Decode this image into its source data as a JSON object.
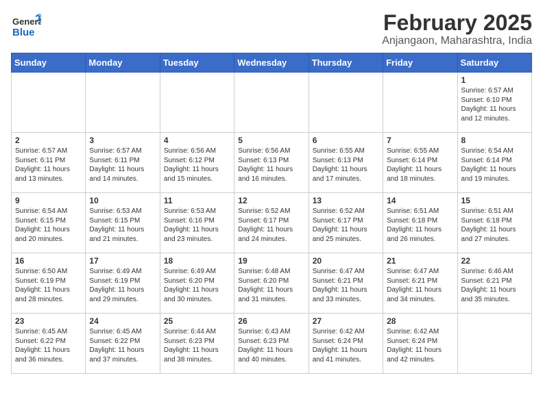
{
  "header": {
    "logo_general": "General",
    "logo_blue": "Blue",
    "month_title": "February 2025",
    "location": "Anjangaon, Maharashtra, India"
  },
  "weekdays": [
    "Sunday",
    "Monday",
    "Tuesday",
    "Wednesday",
    "Thursday",
    "Friday",
    "Saturday"
  ],
  "weeks": [
    [
      {
        "day": "",
        "info": ""
      },
      {
        "day": "",
        "info": ""
      },
      {
        "day": "",
        "info": ""
      },
      {
        "day": "",
        "info": ""
      },
      {
        "day": "",
        "info": ""
      },
      {
        "day": "",
        "info": ""
      },
      {
        "day": "1",
        "info": "Sunrise: 6:57 AM\nSunset: 6:10 PM\nDaylight: 11 hours\nand 12 minutes."
      }
    ],
    [
      {
        "day": "2",
        "info": "Sunrise: 6:57 AM\nSunset: 6:11 PM\nDaylight: 11 hours\nand 13 minutes."
      },
      {
        "day": "3",
        "info": "Sunrise: 6:57 AM\nSunset: 6:11 PM\nDaylight: 11 hours\nand 14 minutes."
      },
      {
        "day": "4",
        "info": "Sunrise: 6:56 AM\nSunset: 6:12 PM\nDaylight: 11 hours\nand 15 minutes."
      },
      {
        "day": "5",
        "info": "Sunrise: 6:56 AM\nSunset: 6:13 PM\nDaylight: 11 hours\nand 16 minutes."
      },
      {
        "day": "6",
        "info": "Sunrise: 6:55 AM\nSunset: 6:13 PM\nDaylight: 11 hours\nand 17 minutes."
      },
      {
        "day": "7",
        "info": "Sunrise: 6:55 AM\nSunset: 6:14 PM\nDaylight: 11 hours\nand 18 minutes."
      },
      {
        "day": "8",
        "info": "Sunrise: 6:54 AM\nSunset: 6:14 PM\nDaylight: 11 hours\nand 19 minutes."
      }
    ],
    [
      {
        "day": "9",
        "info": "Sunrise: 6:54 AM\nSunset: 6:15 PM\nDaylight: 11 hours\nand 20 minutes."
      },
      {
        "day": "10",
        "info": "Sunrise: 6:53 AM\nSunset: 6:15 PM\nDaylight: 11 hours\nand 21 minutes."
      },
      {
        "day": "11",
        "info": "Sunrise: 6:53 AM\nSunset: 6:16 PM\nDaylight: 11 hours\nand 23 minutes."
      },
      {
        "day": "12",
        "info": "Sunrise: 6:52 AM\nSunset: 6:17 PM\nDaylight: 11 hours\nand 24 minutes."
      },
      {
        "day": "13",
        "info": "Sunrise: 6:52 AM\nSunset: 6:17 PM\nDaylight: 11 hours\nand 25 minutes."
      },
      {
        "day": "14",
        "info": "Sunrise: 6:51 AM\nSunset: 6:18 PM\nDaylight: 11 hours\nand 26 minutes."
      },
      {
        "day": "15",
        "info": "Sunrise: 6:51 AM\nSunset: 6:18 PM\nDaylight: 11 hours\nand 27 minutes."
      }
    ],
    [
      {
        "day": "16",
        "info": "Sunrise: 6:50 AM\nSunset: 6:19 PM\nDaylight: 11 hours\nand 28 minutes."
      },
      {
        "day": "17",
        "info": "Sunrise: 6:49 AM\nSunset: 6:19 PM\nDaylight: 11 hours\nand 29 minutes."
      },
      {
        "day": "18",
        "info": "Sunrise: 6:49 AM\nSunset: 6:20 PM\nDaylight: 11 hours\nand 30 minutes."
      },
      {
        "day": "19",
        "info": "Sunrise: 6:48 AM\nSunset: 6:20 PM\nDaylight: 11 hours\nand 31 minutes."
      },
      {
        "day": "20",
        "info": "Sunrise: 6:47 AM\nSunset: 6:21 PM\nDaylight: 11 hours\nand 33 minutes."
      },
      {
        "day": "21",
        "info": "Sunrise: 6:47 AM\nSunset: 6:21 PM\nDaylight: 11 hours\nand 34 minutes."
      },
      {
        "day": "22",
        "info": "Sunrise: 6:46 AM\nSunset: 6:21 PM\nDaylight: 11 hours\nand 35 minutes."
      }
    ],
    [
      {
        "day": "23",
        "info": "Sunrise: 6:45 AM\nSunset: 6:22 PM\nDaylight: 11 hours\nand 36 minutes."
      },
      {
        "day": "24",
        "info": "Sunrise: 6:45 AM\nSunset: 6:22 PM\nDaylight: 11 hours\nand 37 minutes."
      },
      {
        "day": "25",
        "info": "Sunrise: 6:44 AM\nSunset: 6:23 PM\nDaylight: 11 hours\nand 38 minutes."
      },
      {
        "day": "26",
        "info": "Sunrise: 6:43 AM\nSunset: 6:23 PM\nDaylight: 11 hours\nand 40 minutes."
      },
      {
        "day": "27",
        "info": "Sunrise: 6:42 AM\nSunset: 6:24 PM\nDaylight: 11 hours\nand 41 minutes."
      },
      {
        "day": "28",
        "info": "Sunrise: 6:42 AM\nSunset: 6:24 PM\nDaylight: 11 hours\nand 42 minutes."
      },
      {
        "day": "",
        "info": ""
      }
    ]
  ]
}
